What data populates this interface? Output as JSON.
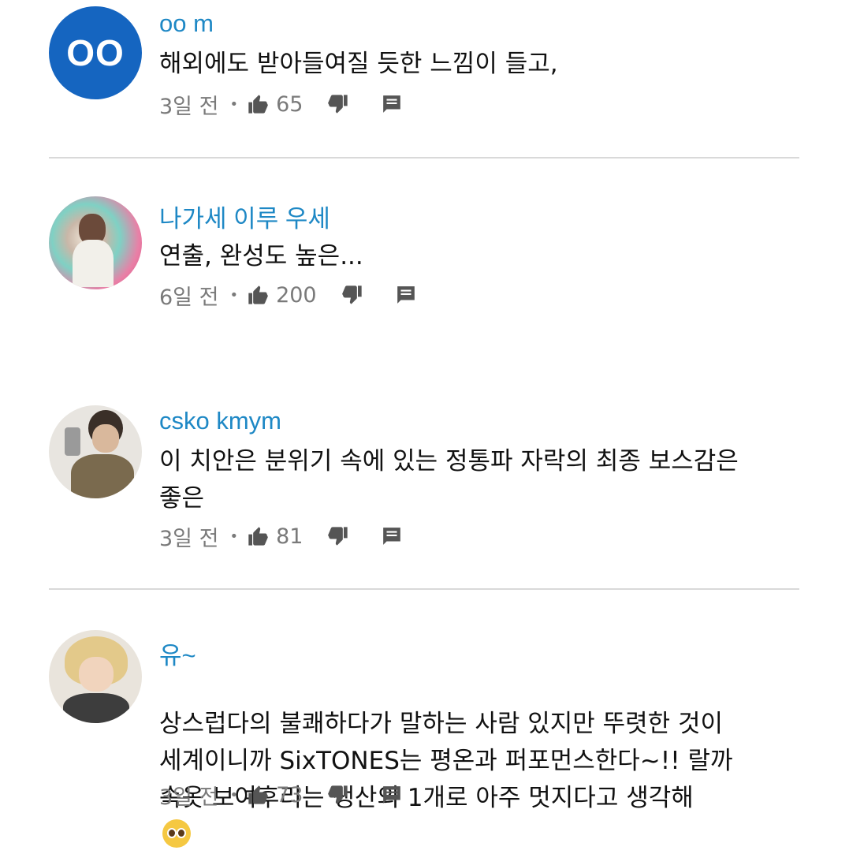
{
  "comments": [
    {
      "author": "oo m",
      "avatar_initials": "OO",
      "avatar_color": "#1565c0",
      "text": "해외에도 받아들여질 듯한 느낌이 들고,",
      "time": "3일 전",
      "likes": "65"
    },
    {
      "author": "나가세 이루 우세",
      "text": "연출, 완성도 높은...",
      "time": "6일 전",
      "likes": "200"
    },
    {
      "author": "csko kmym",
      "text": "이 치안은 분위기 속에 있는 정통파 자락의 최종 보스감은\n좋은",
      "time": "3일 전",
      "likes": "81"
    },
    {
      "author": "유~",
      "text": "상스럽다의 불쾌하다가 말하는 사람 있지만 뚜렷한 것이\n세계이니까 SixTONES는 평온과 퍼포먼스한다~!! 랄까\n속옷 보여후리는 생산의 1개로 아주 멋지다고 생각해",
      "emoji": "pleading-face-emoji",
      "time": "3일 전",
      "likes": "73"
    }
  ],
  "meta_separator": "•",
  "colors": {
    "author": "#1e88c5",
    "meta": "#7a7a7a",
    "divider": "#d9d9d9"
  }
}
